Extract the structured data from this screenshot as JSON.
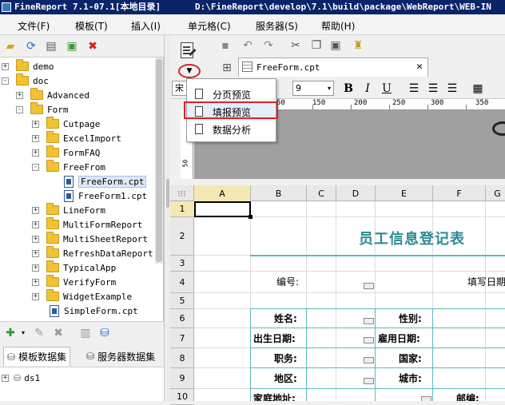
{
  "window": {
    "title": "FineReport 7.1-07.1[本地目录]",
    "path": "D:\\FineReport\\develop\\7.1\\build\\package\\WebReport\\WEB-IN"
  },
  "menu": [
    "文件(F)",
    "模板(T)",
    "插入(I)",
    "单元格(C)",
    "服务器(S)",
    "帮助(H)"
  ],
  "tree": {
    "items": [
      {
        "label": "demo",
        "type": "folder",
        "expander": "+"
      },
      {
        "label": "doc",
        "type": "folder",
        "expander": "-"
      },
      {
        "label": "Advanced",
        "type": "folder",
        "expander": "+"
      },
      {
        "label": "Form",
        "type": "folder",
        "expander": "-"
      },
      {
        "label": "Cutpage",
        "type": "folder",
        "expander": "+"
      },
      {
        "label": "ExcelImport",
        "type": "folder",
        "expander": "+"
      },
      {
        "label": "FormFAQ",
        "type": "folder",
        "expander": "+"
      },
      {
        "label": "FreeFrom",
        "type": "folder",
        "expander": "-"
      },
      {
        "label": "FreeForm.cpt",
        "type": "file",
        "selected": true
      },
      {
        "label": "FreeForm1.cpt",
        "type": "file"
      },
      {
        "label": "LineForm",
        "type": "folder",
        "expander": "+"
      },
      {
        "label": "MultiFormReport",
        "type": "folder",
        "expander": "+"
      },
      {
        "label": "MultiSheetReport",
        "type": "folder",
        "expander": "+"
      },
      {
        "label": "RefreshDataReport",
        "type": "folder",
        "expander": "+"
      },
      {
        "label": "TypicalApp",
        "type": "folder",
        "expander": "+"
      },
      {
        "label": "VerifyForm",
        "type": "folder",
        "expander": "+"
      },
      {
        "label": "WidgetExample",
        "type": "folder",
        "expander": "+"
      },
      {
        "label": "SimpleForm.cpt",
        "type": "file"
      }
    ]
  },
  "datasets": {
    "tab1": "模板数据集",
    "tab2": "服务器数据集",
    "items": [
      "ds1"
    ]
  },
  "editor": {
    "tab_label": "FreeForm.cpt",
    "font": "宋",
    "font_size": "9",
    "ruler_labels": [
      "50",
      "100",
      "150",
      "200",
      "250",
      "300",
      "350"
    ],
    "vruler_label": "50",
    "columns": [
      "A",
      "B",
      "C",
      "D",
      "E",
      "F",
      "G"
    ],
    "rows": [
      "1",
      "2",
      "3",
      "4",
      "5",
      "6",
      "7",
      "8",
      "9",
      "10"
    ],
    "form_title": "员工信息登记表",
    "fields": {
      "no": "编号:",
      "fill_date": "填写日期",
      "name": "姓名:",
      "sex": "性别:",
      "birth": "出生日期:",
      "hire": "雇用日期:",
      "job": "职务:",
      "country": "国家:",
      "region": "地区:",
      "city": "城市:",
      "address": "家庭地址:",
      "postcode": "邮编:"
    }
  },
  "preview_menu": {
    "items": [
      "分页预览",
      "填报预览",
      "数据分析"
    ],
    "highlighted": 1
  },
  "accent": {
    "highlight_red": "#d9232a",
    "title_teal": "#2a8a96"
  }
}
